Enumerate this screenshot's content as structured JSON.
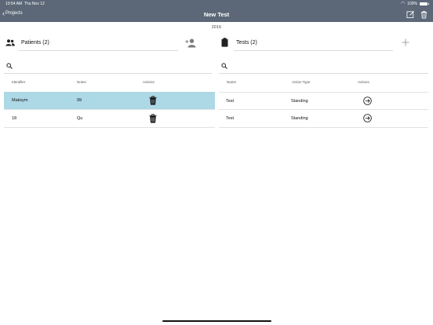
{
  "status": {
    "time": "10:54 AM",
    "date": "Thu Nov 12",
    "battery": "100%"
  },
  "nav": {
    "back_label": "Projects",
    "title": "New Test"
  },
  "year": "2016",
  "patients": {
    "title": "Patients (2)",
    "columns": [
      "Identifier",
      "Notes",
      "Actions"
    ],
    "rows": [
      {
        "identifier": "Maksym",
        "notes": "99",
        "selected": true
      },
      {
        "identifier": "18",
        "notes": "Qu",
        "selected": false
      }
    ]
  },
  "tests": {
    "title": "Tests (2)",
    "columns": [
      "Name",
      "Action Type",
      "Actions"
    ],
    "rows": [
      {
        "name": "Test",
        "action_type": "Standing"
      },
      {
        "name": "Test",
        "action_type": "Standing"
      }
    ]
  },
  "colors": {
    "navbar": "#5c6878",
    "selected_row": "#add8e6"
  },
  "icons": [
    "back-chevron-icon",
    "edit-icon",
    "trash-icon",
    "people-icon",
    "add-person-icon",
    "clipboard-icon",
    "plus-icon",
    "search-icon",
    "arrow-circle-right-icon"
  ]
}
